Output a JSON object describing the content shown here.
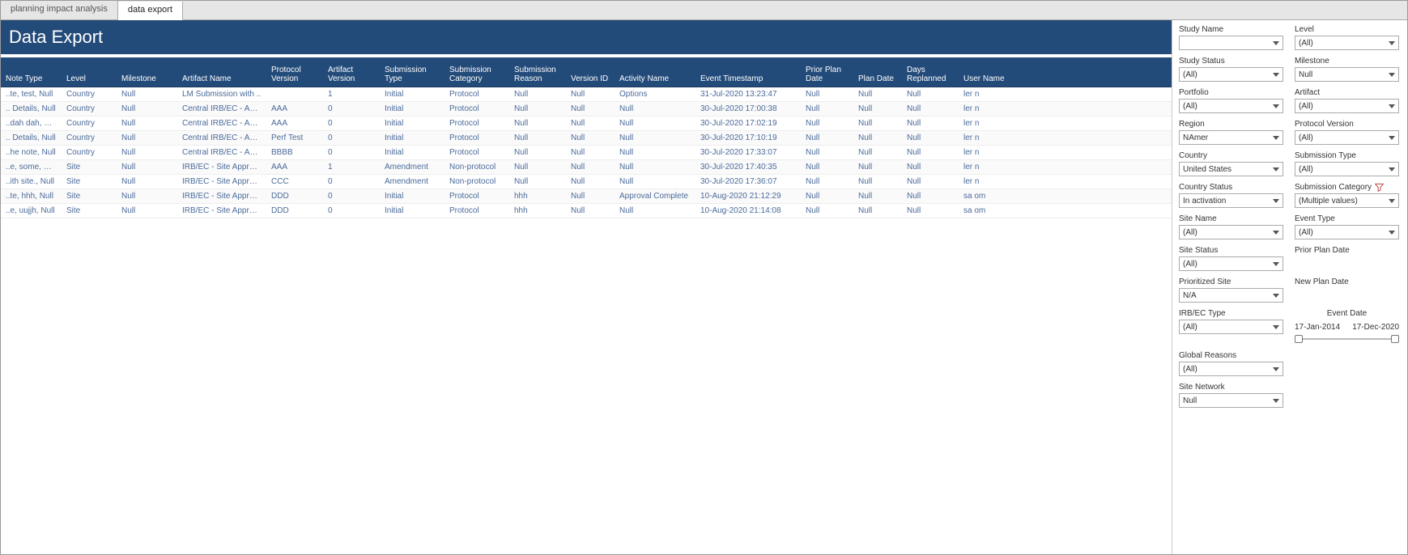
{
  "tabs": [
    {
      "label": "planning impact analysis",
      "active": false
    },
    {
      "label": "data export",
      "active": true
    }
  ],
  "title": "Data Export",
  "columns": [
    "Note Type",
    "Level",
    "Milestone",
    "Artifact Name",
    "Protocol Version",
    "Artifact Version",
    "Submission Type",
    "Submission Category",
    "Submission Reason",
    "Version ID",
    "Activity Name",
    "Event Timestamp",
    "Prior Plan Date",
    "Plan Date",
    "Days Replanned",
    "User Name"
  ],
  "rows": [
    {
      "note": "..te, test, Null",
      "level": "Country",
      "mile": "Null",
      "art": "LM Submission with ..",
      "pver": "",
      "aver": "1",
      "stype": "Initial",
      "scat": "Protocol",
      "sreas": "Null",
      "vid": "Null",
      "act": "Options",
      "ts": "31-Jul-2020 13:23:47",
      "ppd": "Null",
      "pd": "Null",
      "drp": "Null",
      "user": "ler                                       n"
    },
    {
      "note": ".. Details, Null",
      "level": "Country",
      "mile": "Null",
      "art": "Central IRB/EC - App..",
      "pver": "AAA",
      "aver": "0",
      "stype": "Initial",
      "scat": "Protocol",
      "sreas": "Null",
      "vid": "Null",
      "act": "Null",
      "ts": "30-Jul-2020 17:00:38",
      "ppd": "Null",
      "pd": "Null",
      "drp": "Null",
      "user": "ler                                       n"
    },
    {
      "note": "..dah dah, Null",
      "level": "Country",
      "mile": "Null",
      "art": "Central IRB/EC - App..",
      "pver": "AAA",
      "aver": "0",
      "stype": "Initial",
      "scat": "Protocol",
      "sreas": "Null",
      "vid": "Null",
      "act": "Null",
      "ts": "30-Jul-2020 17:02:19",
      "ppd": "Null",
      "pd": "Null",
      "drp": "Null",
      "user": "ler                                       n"
    },
    {
      "note": ".. Details, Null",
      "level": "Country",
      "mile": "Null",
      "art": "Central IRB/EC - App..",
      "pver": "Perf Test",
      "aver": "0",
      "stype": "Initial",
      "scat": "Protocol",
      "sreas": "Null",
      "vid": "Null",
      "act": "Null",
      "ts": "30-Jul-2020 17:10:19",
      "ppd": "Null",
      "pd": "Null",
      "drp": "Null",
      "user": "ler                                       n"
    },
    {
      "note": "..he note, Null",
      "level": "Country",
      "mile": "Null",
      "art": "Central IRB/EC - App..",
      "pver": "BBBB",
      "aver": "0",
      "stype": "Initial",
      "scat": "Protocol",
      "sreas": "Null",
      "vid": "Null",
      "act": "Null",
      "ts": "30-Jul-2020 17:33:07",
      "ppd": "Null",
      "pd": "Null",
      "drp": "Null",
      "user": "ler                                       n"
    },
    {
      "note": "..e, some, Null",
      "level": "Site",
      "mile": "Null",
      "art": "IRB/EC - Site Approval",
      "pver": "AAA",
      "aver": "1",
      "stype": "Amendment",
      "scat": "Non-protocol",
      "sreas": "Null",
      "vid": "Null",
      "act": "Null",
      "ts": "30-Jul-2020 17:40:35",
      "ppd": "Null",
      "pd": "Null",
      "drp": "Null",
      "user": "ler                                       n"
    },
    {
      "note": "..ith site., Null",
      "level": "Site",
      "mile": "Null",
      "art": "IRB/EC - Site Approval",
      "pver": "CCC",
      "aver": "0",
      "stype": "Amendment",
      "scat": "Non-protocol",
      "sreas": "Null",
      "vid": "Null",
      "act": "Null",
      "ts": "30-Jul-2020 17:36:07",
      "ppd": "Null",
      "pd": "Null",
      "drp": "Null",
      "user": "ler                                       n"
    },
    {
      "note": "..te, hhh, Null",
      "level": "Site",
      "mile": "Null",
      "art": "IRB/EC - Site Approval",
      "pver": "DDD",
      "aver": "0",
      "stype": "Initial",
      "scat": "Protocol",
      "sreas": "hhh",
      "vid": "Null",
      "act": "Approval Complete",
      "ts": "10-Aug-2020 21:12:29",
      "ppd": "Null",
      "pd": "Null",
      "drp": "Null",
      "user": "sa                                       om"
    },
    {
      "note": "..e, uujjh, Null",
      "level": "Site",
      "mile": "Null",
      "art": "IRB/EC - Site Approval",
      "pver": "DDD",
      "aver": "0",
      "stype": "Initial",
      "scat": "Protocol",
      "sreas": "hhh",
      "vid": "Null",
      "act": "Null",
      "ts": "10-Aug-2020 21:14:08",
      "ppd": "Null",
      "pd": "Null",
      "drp": "Null",
      "user": "sa                                       om"
    }
  ],
  "filters": {
    "study_name": {
      "label": "Study Name",
      "value": ""
    },
    "level": {
      "label": "Level",
      "value": "(All)"
    },
    "study_status": {
      "label": "Study Status",
      "value": "(All)"
    },
    "milestone": {
      "label": "Milestone",
      "value": "Null"
    },
    "portfolio": {
      "label": "Portfolio",
      "value": "(All)"
    },
    "artifact": {
      "label": "Artifact",
      "value": "(All)"
    },
    "region": {
      "label": "Region",
      "value": "NAmer"
    },
    "protocol_version": {
      "label": "Protocol Version",
      "value": "(All)"
    },
    "country": {
      "label": "Country",
      "value": "United States"
    },
    "submission_type": {
      "label": "Submission Type",
      "value": "(All)"
    },
    "country_status": {
      "label": "Country Status",
      "value": "In activation"
    },
    "submission_category": {
      "label": "Submission Category",
      "value": "(Multiple values)"
    },
    "site_name": {
      "label": "Site Name",
      "value": "(All)"
    },
    "event_type": {
      "label": "Event Type",
      "value": "(All)"
    },
    "site_status": {
      "label": "Site Status",
      "value": "(All)"
    },
    "prior_plan_date": {
      "label": "Prior Plan Date"
    },
    "prioritized_site": {
      "label": "Prioritized Site",
      "value": "N/A"
    },
    "new_plan_date": {
      "label": "New Plan Date"
    },
    "irb_ec_type": {
      "label": "IRB/EC Type",
      "value": "(All)"
    },
    "event_date": {
      "label": "Event Date",
      "from": "17-Jan-2014",
      "to": "17-Dec-2020"
    },
    "global_reasons": {
      "label": "Global Reasons",
      "value": "(All)"
    },
    "site_network": {
      "label": "Site Network",
      "value": "Null"
    }
  }
}
